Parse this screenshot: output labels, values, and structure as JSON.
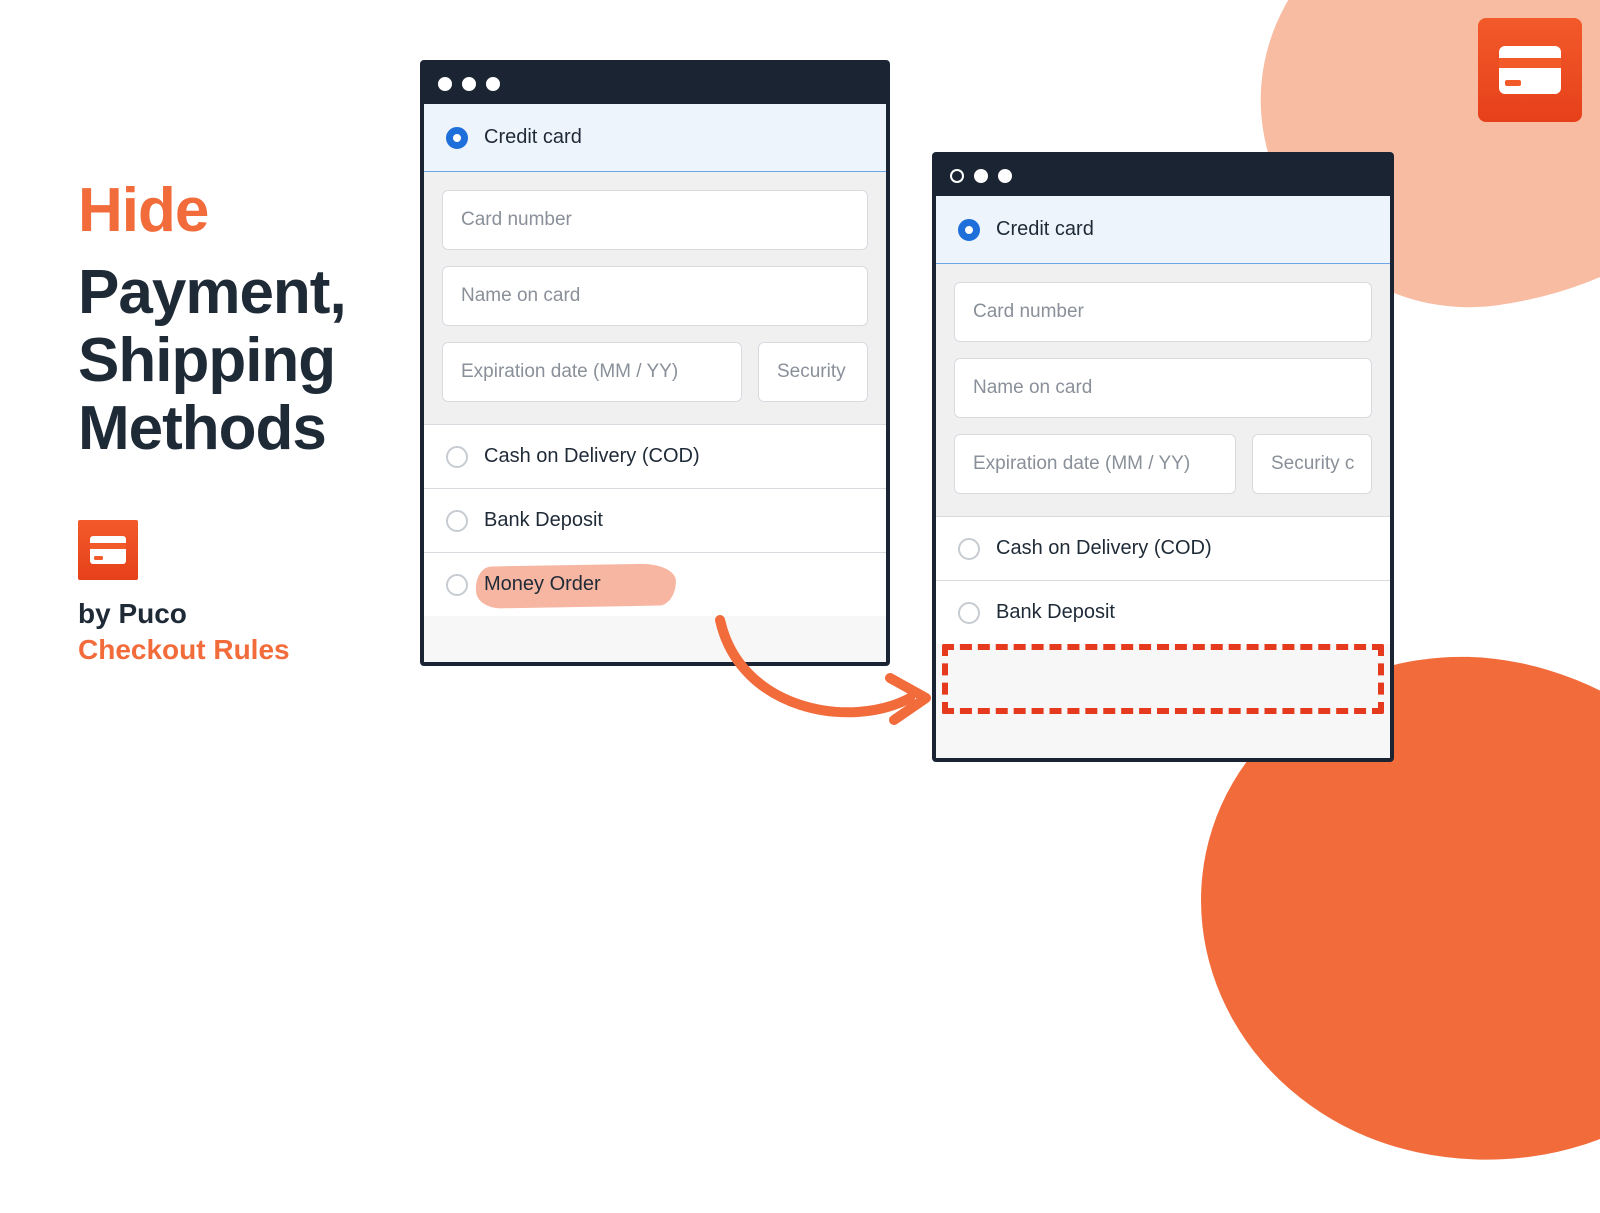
{
  "promo": {
    "headline_highlight": "Hide",
    "headline_line1": "Payment,",
    "headline_line2": "Shipping",
    "headline_line3": "Methods",
    "by_label": "by Puco",
    "product_name": "Checkout Rules"
  },
  "window_before": {
    "options": {
      "credit_card": "Credit card",
      "cod": "Cash on Delivery (COD)",
      "bank_deposit": "Bank Deposit",
      "money_order": "Money Order"
    },
    "fields": {
      "card_number": "Card number",
      "name_on_card": "Name on card",
      "expiration": "Expiration date (MM / YY)",
      "security": "Security"
    }
  },
  "window_after": {
    "options": {
      "credit_card": "Credit card",
      "cod": "Cash on Delivery (COD)",
      "bank_deposit": "Bank Deposit"
    },
    "fields": {
      "card_number": "Card number",
      "name_on_card": "Name on card",
      "expiration": "Expiration date (MM / YY)",
      "security": "Security c"
    }
  }
}
